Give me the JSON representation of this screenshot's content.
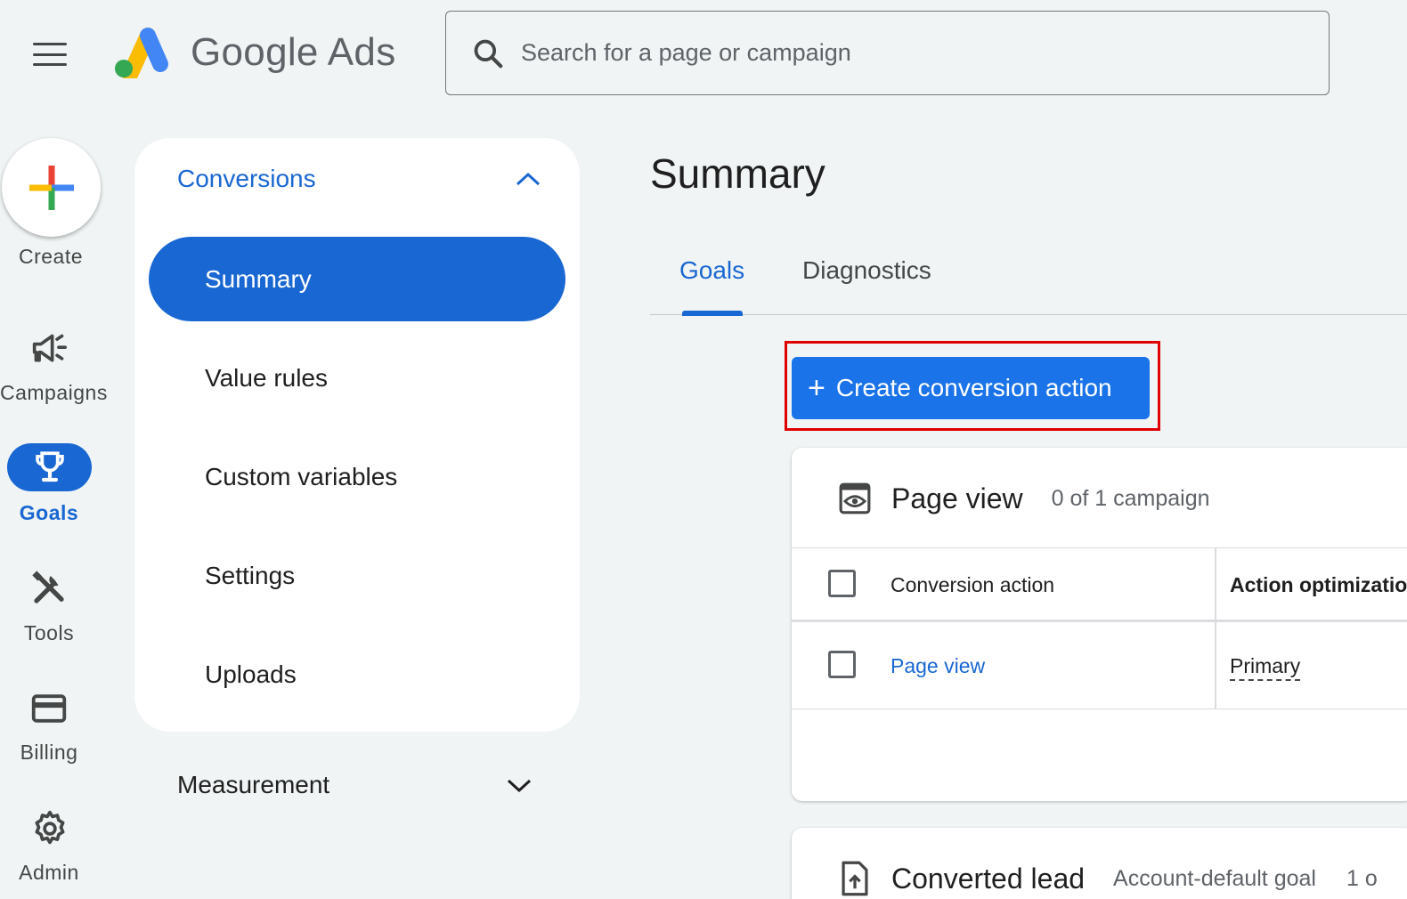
{
  "header": {
    "app_title": "Google Ads",
    "search_placeholder": "Search for a page or campaign"
  },
  "rail": {
    "create": "Create",
    "campaigns": "Campaigns",
    "goals": "Goals",
    "tools": "Tools",
    "billing": "Billing",
    "admin": "Admin"
  },
  "nav": {
    "section": "Conversions",
    "items": [
      "Summary",
      "Value rules",
      "Custom variables",
      "Settings",
      "Uploads"
    ],
    "measurement": "Measurement"
  },
  "main": {
    "title": "Summary",
    "tabs": [
      "Goals",
      "Diagnostics"
    ],
    "create_button": "Create conversion action",
    "card1": {
      "title": "Page view",
      "subtitle": "0 of 1 campaign",
      "columns": [
        "Conversion action",
        "Action optimizatio"
      ],
      "row": {
        "action": "Page view",
        "optimization": "Primary"
      }
    },
    "card2": {
      "title": "Converted lead",
      "subtitle": "Account-default goal",
      "extra": "1 o"
    }
  },
  "colors": {
    "accent": "#1967d2",
    "button": "#1a73e8",
    "highlight": "#e00000",
    "background": "#f0f4f4"
  }
}
